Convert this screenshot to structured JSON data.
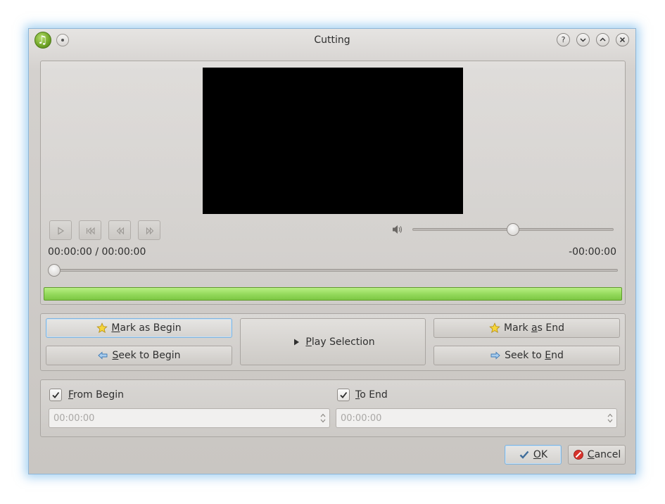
{
  "window": {
    "title": "Cutting"
  },
  "titlebar_buttons": [
    "help",
    "minimize",
    "maximize",
    "close"
  ],
  "help_glyph": "?",
  "player": {
    "time_position": "00:00:00 / 00:00:00",
    "time_remaining": "-00:00:00",
    "volume_level": 0.5,
    "seek_level": 0.0,
    "buttons": [
      "play-icon",
      "skip-back-icon",
      "rewind-icon",
      "fast-forward-icon"
    ]
  },
  "selection": {
    "mark_begin": {
      "pre": "",
      "key": "M",
      "post": "ark as Begin"
    },
    "seek_begin": {
      "pre": "",
      "key": "S",
      "post": "eek to Begin"
    },
    "play_selection": {
      "pre": "",
      "key": "P",
      "post": "lay Selection"
    },
    "mark_end": {
      "pre": "Mark ",
      "key": "a",
      "post": "s End"
    },
    "seek_end": {
      "pre": "Seek to ",
      "key": "E",
      "post": "nd"
    }
  },
  "range": {
    "from_begin": {
      "key": "F",
      "post": "rom Begin",
      "checked": true,
      "value": "00:00:00"
    },
    "to_end": {
      "key": "T",
      "post": "o End",
      "checked": true,
      "value": "00:00:00"
    }
  },
  "dialog_buttons": {
    "ok": {
      "key": "O",
      "post": "K"
    },
    "cancel": {
      "key": "C",
      "post": "ancel"
    }
  },
  "colors": {
    "progress": "#92d85a",
    "focus": "#7fb4df",
    "video": "#000000"
  }
}
